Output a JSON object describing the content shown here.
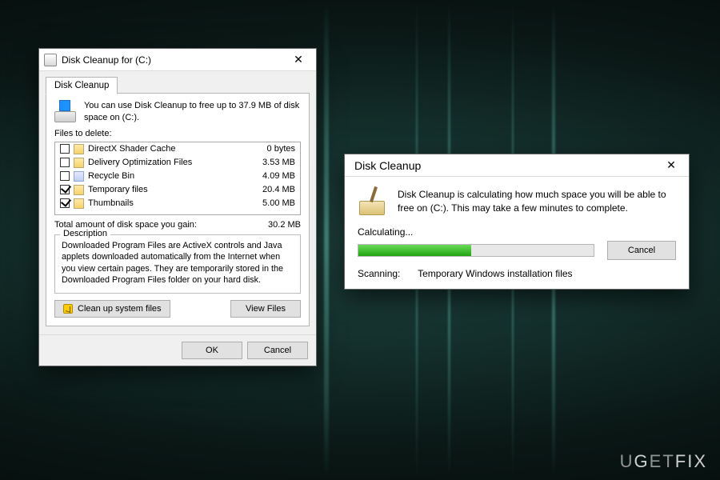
{
  "watermark": "UGETFIX",
  "main_dialog": {
    "title": "Disk Cleanup for  (C:)",
    "tab_label": "Disk Cleanup",
    "intro": "You can use Disk Cleanup to free up to 37.9 MB of disk space on  (C:).",
    "files_to_delete_label": "Files to delete:",
    "items": [
      {
        "name": "DirectX Shader Cache",
        "size": "0 bytes",
        "checked": false,
        "icon": "file"
      },
      {
        "name": "Delivery Optimization Files",
        "size": "3.53 MB",
        "checked": false,
        "icon": "file"
      },
      {
        "name": "Recycle Bin",
        "size": "4.09 MB",
        "checked": false,
        "icon": "bin"
      },
      {
        "name": "Temporary files",
        "size": "20.4 MB",
        "checked": true,
        "icon": "file"
      },
      {
        "name": "Thumbnails",
        "size": "5.00 MB",
        "checked": true,
        "icon": "file"
      }
    ],
    "total_label": "Total amount of disk space you gain:",
    "total_value": "30.2 MB",
    "description_legend": "Description",
    "description_text": "Downloaded Program Files are ActiveX controls and Java applets downloaded automatically from the Internet when you view certain pages. They are temporarily stored in the Downloaded Program Files folder on your hard disk.",
    "clean_system_files_btn": "Clean up system files",
    "view_files_btn": "View Files",
    "ok_btn": "OK",
    "cancel_btn": "Cancel"
  },
  "calc_dialog": {
    "title": "Disk Cleanup",
    "message": "Disk Cleanup is calculating how much space you will be able to free on  (C:). This may take a few minutes to complete.",
    "progress_label": "Calculating...",
    "progress_percent": 48,
    "cancel_btn": "Cancel",
    "scanning_label": "Scanning:",
    "scanning_value": "Temporary Windows installation files"
  }
}
